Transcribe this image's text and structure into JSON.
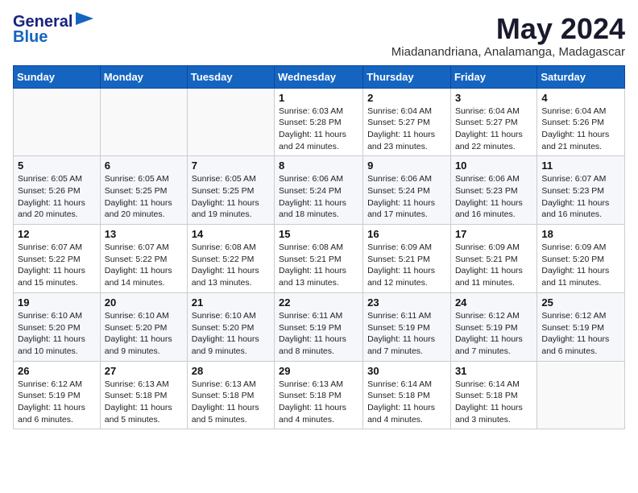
{
  "brand": {
    "name_part1": "General",
    "name_part2": "Blue"
  },
  "header": {
    "title": "May 2024",
    "subtitle": "Miadanandriana, Analamanga, Madagascar"
  },
  "weekdays": [
    "Sunday",
    "Monday",
    "Tuesday",
    "Wednesday",
    "Thursday",
    "Friday",
    "Saturday"
  ],
  "weeks": [
    [
      {
        "day": "",
        "info": ""
      },
      {
        "day": "",
        "info": ""
      },
      {
        "day": "",
        "info": ""
      },
      {
        "day": "1",
        "info": "Sunrise: 6:03 AM\nSunset: 5:28 PM\nDaylight: 11 hours\nand 24 minutes."
      },
      {
        "day": "2",
        "info": "Sunrise: 6:04 AM\nSunset: 5:27 PM\nDaylight: 11 hours\nand 23 minutes."
      },
      {
        "day": "3",
        "info": "Sunrise: 6:04 AM\nSunset: 5:27 PM\nDaylight: 11 hours\nand 22 minutes."
      },
      {
        "day": "4",
        "info": "Sunrise: 6:04 AM\nSunset: 5:26 PM\nDaylight: 11 hours\nand 21 minutes."
      }
    ],
    [
      {
        "day": "5",
        "info": "Sunrise: 6:05 AM\nSunset: 5:26 PM\nDaylight: 11 hours\nand 20 minutes."
      },
      {
        "day": "6",
        "info": "Sunrise: 6:05 AM\nSunset: 5:25 PM\nDaylight: 11 hours\nand 20 minutes."
      },
      {
        "day": "7",
        "info": "Sunrise: 6:05 AM\nSunset: 5:25 PM\nDaylight: 11 hours\nand 19 minutes."
      },
      {
        "day": "8",
        "info": "Sunrise: 6:06 AM\nSunset: 5:24 PM\nDaylight: 11 hours\nand 18 minutes."
      },
      {
        "day": "9",
        "info": "Sunrise: 6:06 AM\nSunset: 5:24 PM\nDaylight: 11 hours\nand 17 minutes."
      },
      {
        "day": "10",
        "info": "Sunrise: 6:06 AM\nSunset: 5:23 PM\nDaylight: 11 hours\nand 16 minutes."
      },
      {
        "day": "11",
        "info": "Sunrise: 6:07 AM\nSunset: 5:23 PM\nDaylight: 11 hours\nand 16 minutes."
      }
    ],
    [
      {
        "day": "12",
        "info": "Sunrise: 6:07 AM\nSunset: 5:22 PM\nDaylight: 11 hours\nand 15 minutes."
      },
      {
        "day": "13",
        "info": "Sunrise: 6:07 AM\nSunset: 5:22 PM\nDaylight: 11 hours\nand 14 minutes."
      },
      {
        "day": "14",
        "info": "Sunrise: 6:08 AM\nSunset: 5:22 PM\nDaylight: 11 hours\nand 13 minutes."
      },
      {
        "day": "15",
        "info": "Sunrise: 6:08 AM\nSunset: 5:21 PM\nDaylight: 11 hours\nand 13 minutes."
      },
      {
        "day": "16",
        "info": "Sunrise: 6:09 AM\nSunset: 5:21 PM\nDaylight: 11 hours\nand 12 minutes."
      },
      {
        "day": "17",
        "info": "Sunrise: 6:09 AM\nSunset: 5:21 PM\nDaylight: 11 hours\nand 11 minutes."
      },
      {
        "day": "18",
        "info": "Sunrise: 6:09 AM\nSunset: 5:20 PM\nDaylight: 11 hours\nand 11 minutes."
      }
    ],
    [
      {
        "day": "19",
        "info": "Sunrise: 6:10 AM\nSunset: 5:20 PM\nDaylight: 11 hours\nand 10 minutes."
      },
      {
        "day": "20",
        "info": "Sunrise: 6:10 AM\nSunset: 5:20 PM\nDaylight: 11 hours\nand 9 minutes."
      },
      {
        "day": "21",
        "info": "Sunrise: 6:10 AM\nSunset: 5:20 PM\nDaylight: 11 hours\nand 9 minutes."
      },
      {
        "day": "22",
        "info": "Sunrise: 6:11 AM\nSunset: 5:19 PM\nDaylight: 11 hours\nand 8 minutes."
      },
      {
        "day": "23",
        "info": "Sunrise: 6:11 AM\nSunset: 5:19 PM\nDaylight: 11 hours\nand 7 minutes."
      },
      {
        "day": "24",
        "info": "Sunrise: 6:12 AM\nSunset: 5:19 PM\nDaylight: 11 hours\nand 7 minutes."
      },
      {
        "day": "25",
        "info": "Sunrise: 6:12 AM\nSunset: 5:19 PM\nDaylight: 11 hours\nand 6 minutes."
      }
    ],
    [
      {
        "day": "26",
        "info": "Sunrise: 6:12 AM\nSunset: 5:19 PM\nDaylight: 11 hours\nand 6 minutes."
      },
      {
        "day": "27",
        "info": "Sunrise: 6:13 AM\nSunset: 5:18 PM\nDaylight: 11 hours\nand 5 minutes."
      },
      {
        "day": "28",
        "info": "Sunrise: 6:13 AM\nSunset: 5:18 PM\nDaylight: 11 hours\nand 5 minutes."
      },
      {
        "day": "29",
        "info": "Sunrise: 6:13 AM\nSunset: 5:18 PM\nDaylight: 11 hours\nand 4 minutes."
      },
      {
        "day": "30",
        "info": "Sunrise: 6:14 AM\nSunset: 5:18 PM\nDaylight: 11 hours\nand 4 minutes."
      },
      {
        "day": "31",
        "info": "Sunrise: 6:14 AM\nSunset: 5:18 PM\nDaylight: 11 hours\nand 3 minutes."
      },
      {
        "day": "",
        "info": ""
      }
    ]
  ]
}
